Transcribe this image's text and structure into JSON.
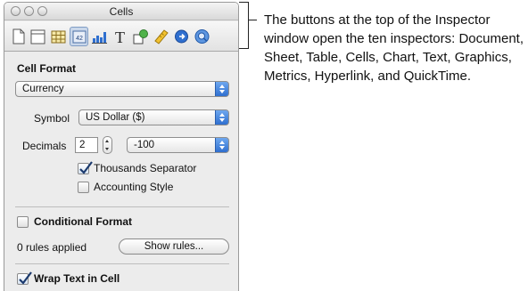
{
  "window": {
    "title": "Cells"
  },
  "toolbar": {
    "buttons": [
      {
        "name": "document-inspector-button",
        "icon": "document-icon"
      },
      {
        "name": "sheet-inspector-button",
        "icon": "sheet-icon"
      },
      {
        "name": "table-inspector-button",
        "icon": "table-icon"
      },
      {
        "name": "cells-inspector-button",
        "icon": "cells-icon",
        "glyph": "42",
        "active": true
      },
      {
        "name": "chart-inspector-button",
        "icon": "chart-icon"
      },
      {
        "name": "text-inspector-button",
        "icon": "text-icon",
        "glyph": "T"
      },
      {
        "name": "graphics-inspector-button",
        "icon": "graphics-icon"
      },
      {
        "name": "metrics-inspector-button",
        "icon": "ruler-icon"
      },
      {
        "name": "hyperlink-inspector-button",
        "icon": "hyperlink-icon"
      },
      {
        "name": "quicktime-inspector-button",
        "icon": "quicktime-icon"
      }
    ]
  },
  "cell_format": {
    "heading": "Cell Format",
    "format_value": "Currency",
    "symbol_label": "Symbol",
    "symbol_value": "US Dollar ($)",
    "decimals_label": "Decimals",
    "decimals_value": "2",
    "negative_value": "-100",
    "thousands_label": "Thousands Separator",
    "thousands_checked": true,
    "accounting_label": "Accounting Style",
    "accounting_checked": false
  },
  "conditional_format": {
    "label": "Conditional Format",
    "checked": false,
    "rules_text": "0 rules applied",
    "show_rules_label": "Show rules..."
  },
  "wrap_text": {
    "label": "Wrap Text in Cell",
    "checked": true
  },
  "caption": {
    "text": "The buttons at the top of the Inspector window open the ten inspectors: Document, Sheet, Table, Cells, Chart, Text, Graphics, Metrics, Hyperlink, and QuickTime."
  },
  "colors": {
    "accent": "#2f6fcf",
    "active_button": "#c9d7ea"
  }
}
